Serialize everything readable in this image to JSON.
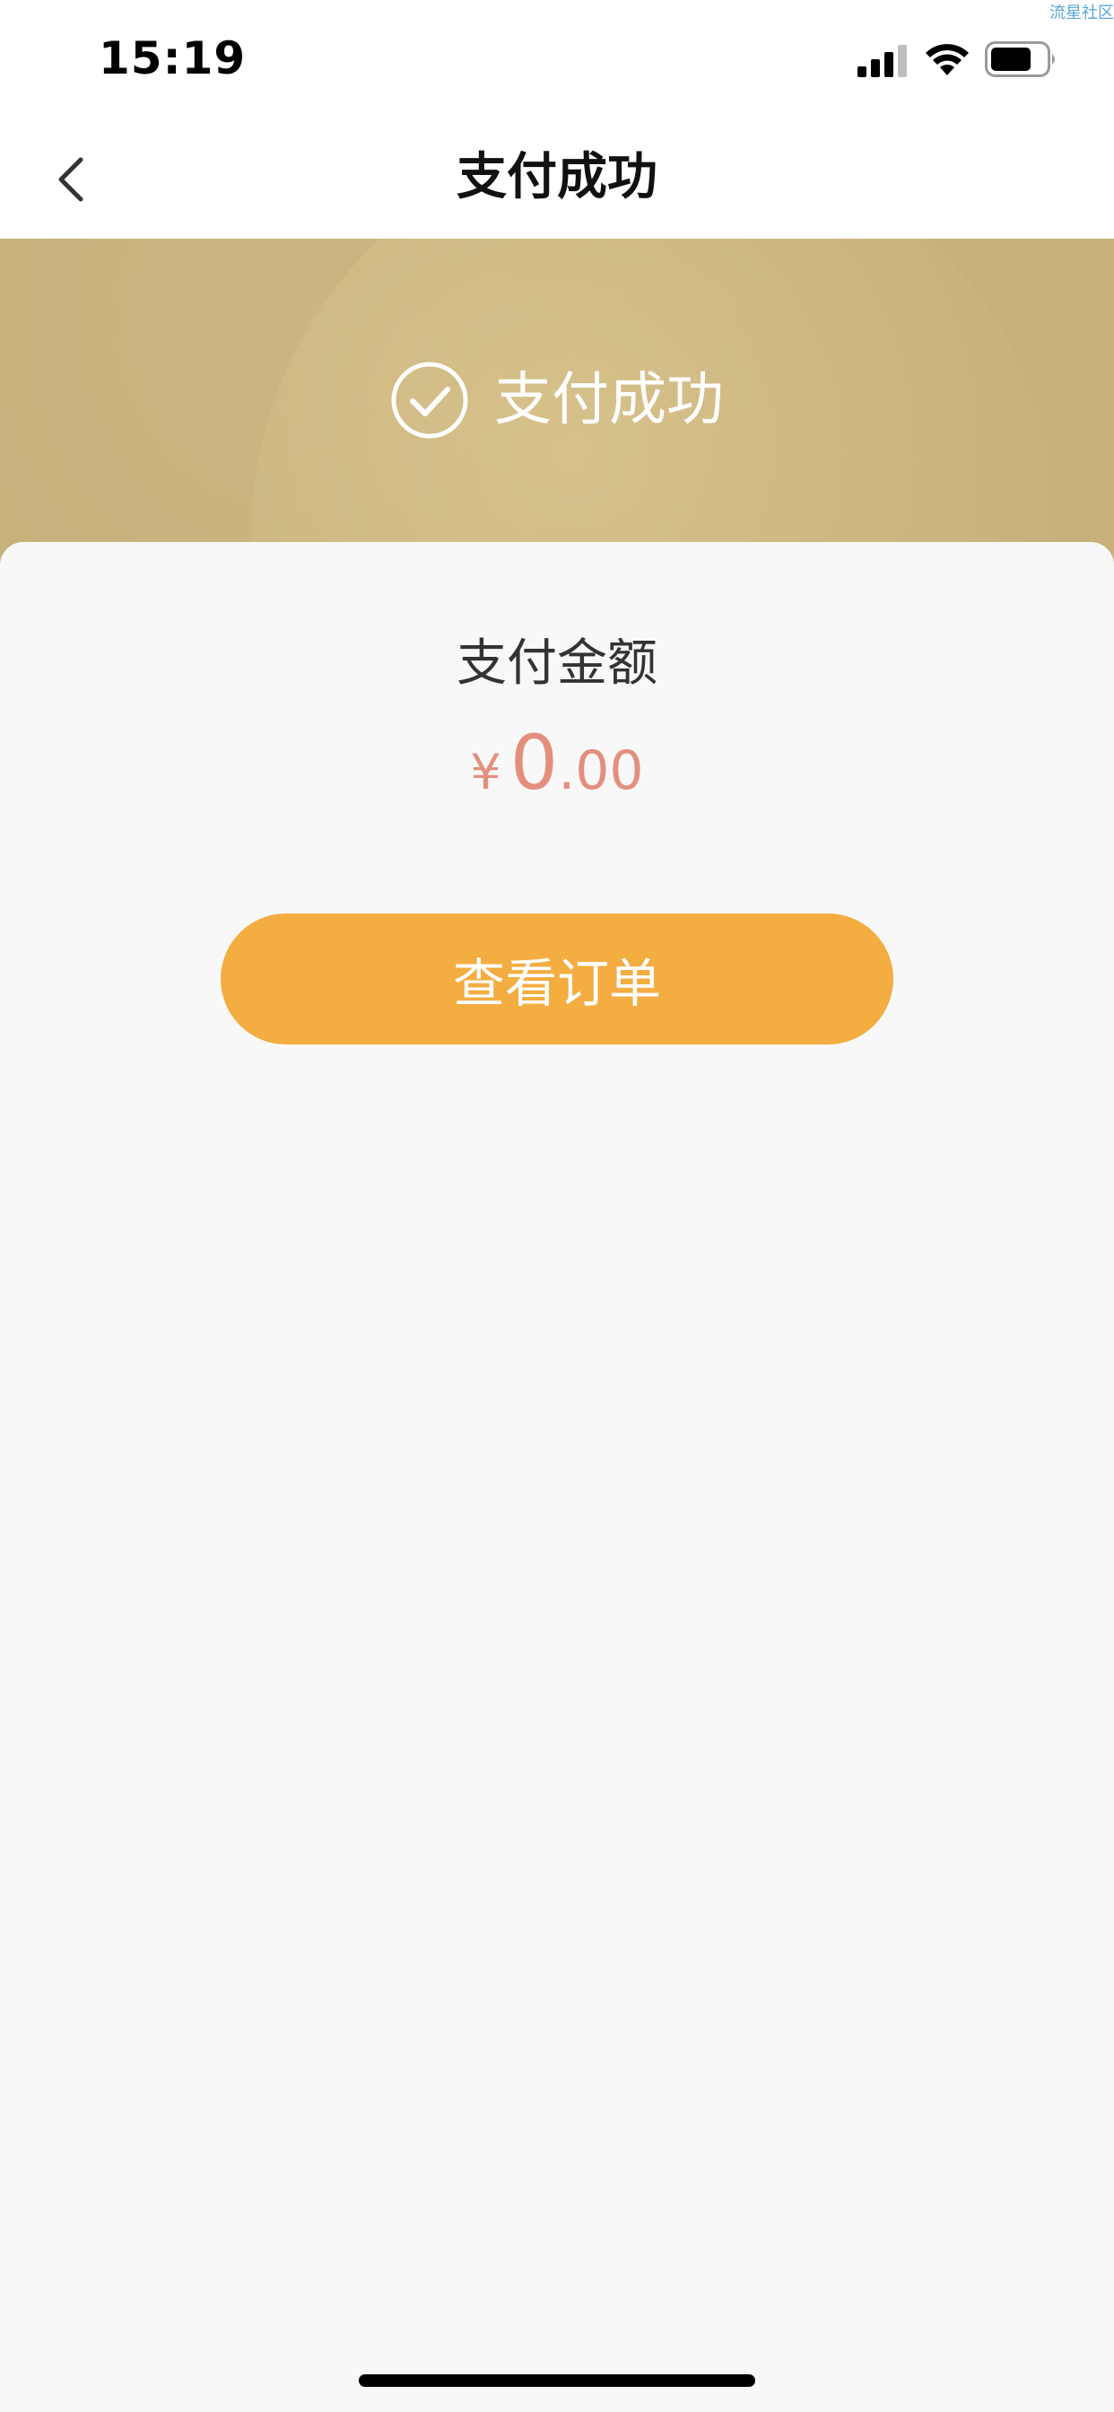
{
  "status_bar": {
    "time": "15:19",
    "watermark": "流星社区"
  },
  "nav": {
    "title": "支付成功"
  },
  "hero": {
    "title": "支付成功",
    "color": "#c7b17b"
  },
  "payment": {
    "amount_label": "支付金额",
    "currency_symbol": "¥",
    "amount_integer": "0",
    "amount_decimal": ".00",
    "amount_color": "#e48f7e"
  },
  "actions": {
    "view_order_label": "查看订单",
    "button_color": "#f3ad41"
  },
  "icons": {
    "back": "chevron-left-icon",
    "success": "check-circle-icon",
    "signal": "signal-icon",
    "wifi": "wifi-icon",
    "battery": "battery-icon"
  }
}
